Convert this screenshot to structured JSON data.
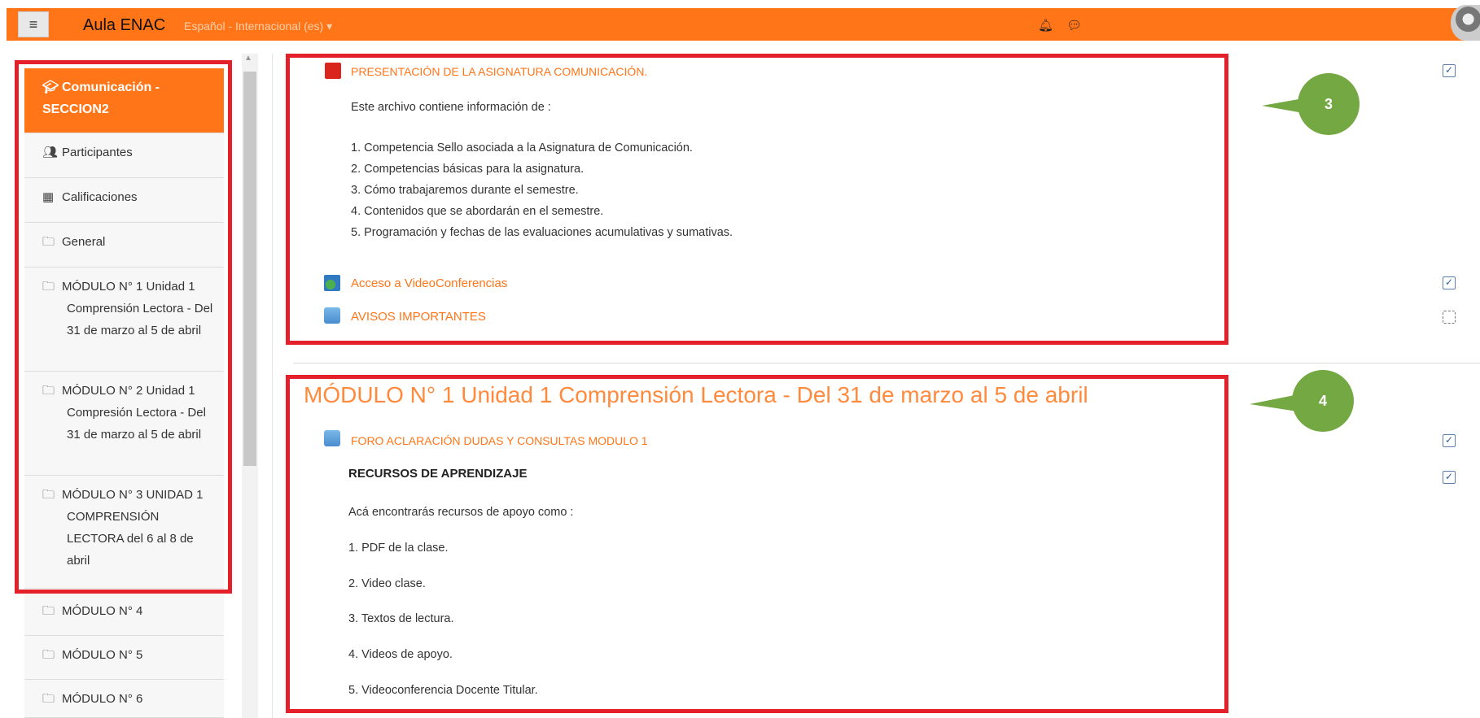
{
  "header": {
    "menu_icon": "hamburger-icon",
    "site_name": "Aula ENAC",
    "language": "Español - Internacional (es) ▾",
    "bell_icon": "bell-icon",
    "chat_icon": "chat-bubble-icon"
  },
  "sidebar": {
    "items": [
      {
        "icon": "graduation-cap-icon",
        "glyph": "🎓",
        "label": "Comunicación - SECCION2"
      },
      {
        "icon": "users-icon",
        "glyph": "👥",
        "label": "Participantes"
      },
      {
        "icon": "table-icon",
        "glyph": "▦",
        "label": "Calificaciones"
      },
      {
        "icon": "folder-icon",
        "glyph": "🗀",
        "label": "General"
      },
      {
        "icon": "folder-icon",
        "glyph": "🗀",
        "label": "MÓDULO N° 1 Unidad 1 Comprensión Lectora - Del 31 de marzo al 5 de abril"
      },
      {
        "icon": "folder-icon",
        "glyph": "🗀",
        "label": "MÓDULO N° 2 Unidad 1 Compresión Lectora - Del 31 de marzo al 5 de abril"
      },
      {
        "icon": "folder-icon",
        "glyph": "🗀",
        "label": "MÓDULO N° 3 UNIDAD 1 COMPRENSIÓN LECTORA del 6 al 8 de abril"
      },
      {
        "icon": "folder-icon",
        "glyph": "🗀",
        "label": "MÓDULO N° 4"
      },
      {
        "icon": "folder-icon",
        "glyph": "🗀",
        "label": "MÓDULO N° 5"
      },
      {
        "icon": "folder-icon",
        "glyph": "🗀",
        "label": "MÓDULO N° 6"
      }
    ]
  },
  "general_section": {
    "pdf_link": "PRESENTACIÓN DE LA ASIGNATURA COMUNICACIÓN.",
    "intro": "Este archivo contiene información de :",
    "list": [
      "1. Competencia Sello asociada a la Asignatura de Comunicación.",
      "2. Competencias básicas para la asignatura.",
      "3. Cómo trabajaremos durante el semestre.",
      "4. Contenidos que se abordarán en el semestre.",
      "5. Programación y fechas de las evaluaciones acumulativas y sumativas."
    ],
    "video_link": "Acceso a VideoConferencias",
    "avisos_link": "AVISOS IMPORTANTES"
  },
  "module1": {
    "title": "MÓDULO N° 1 Unidad 1 Comprensión Lectora - Del 31 de marzo al 5 de abril",
    "forum_link": "FORO ACLARACIÓN DUDAS Y CONSULTAS MODULO 1",
    "resources_heading": "RECURSOS DE APRENDIZAJE",
    "resources_intro": "Acá encontrarás recursos de apoyo como :",
    "resources": [
      "1. PDF de la clase.",
      "2. Video clase.",
      "3. Textos de lectura.",
      "4. Videos de apoyo.",
      "5. Videoconferencia Docente Titular."
    ]
  },
  "callouts": [
    "3",
    "4"
  ],
  "colors": {
    "brand": "#ff7518",
    "highlight": "#e4202a",
    "callout": "#74a843"
  }
}
